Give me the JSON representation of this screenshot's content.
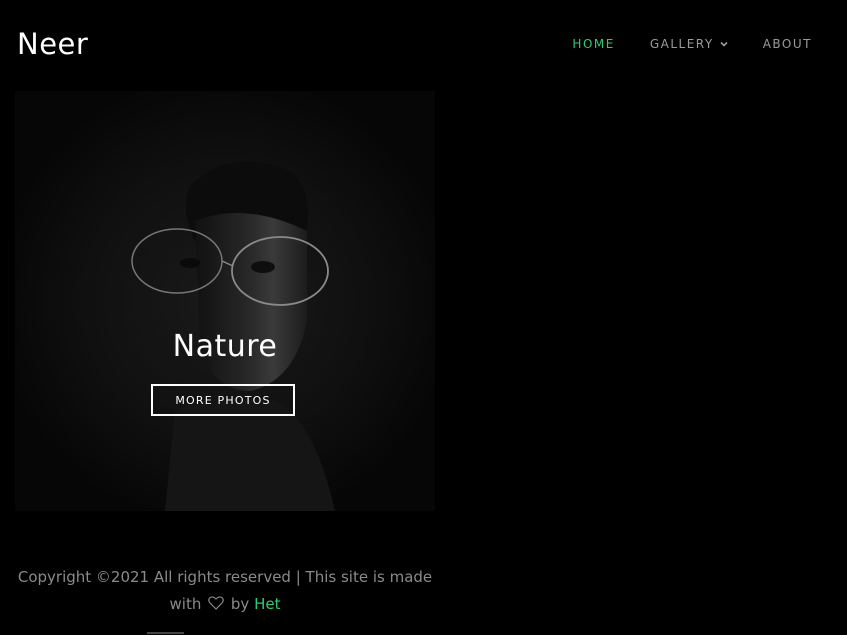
{
  "brand": {
    "name": "Neer"
  },
  "nav": {
    "items": [
      {
        "label": "HOME",
        "active": true
      },
      {
        "label": "GALLERY",
        "active": false,
        "dropdown": true
      },
      {
        "label": "ABOUT",
        "active": false
      }
    ]
  },
  "hero": {
    "title": "Nature",
    "button_label": "MORE PHOTOS"
  },
  "footer": {
    "text_before": "Copyright ©2021 All rights reserved | This site is made with",
    "text_by": "by",
    "author": "Het",
    "heart_icon": "heart-outline-icon"
  },
  "colors": {
    "accent": "#2ecc71",
    "background": "#000000",
    "nav_text": "#9a9a9a"
  }
}
